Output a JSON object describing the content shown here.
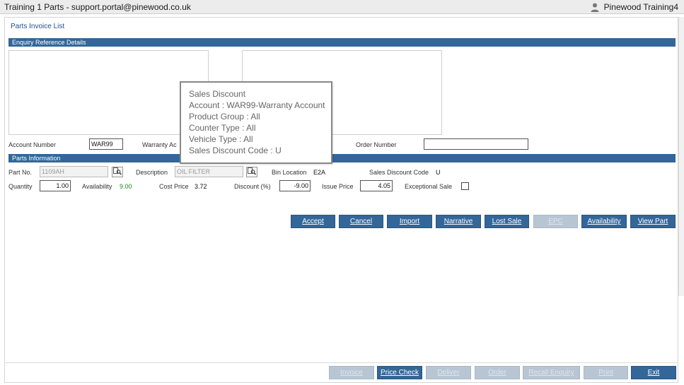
{
  "titlebar": {
    "title": "Training 1 Parts - support.portal@pinewood.co.uk",
    "user": "Pinewood Training4",
    "user_icon": "person-icon"
  },
  "page": {
    "title": "Parts Invoice List"
  },
  "enquiry": {
    "header": "Enquiry Reference Details",
    "account_number_label": "Account Number",
    "account_number_value": "WAR99",
    "warranty_label": "Warranty Ac",
    "order_number_label": "Order Number",
    "order_number_value": ""
  },
  "parts": {
    "header": "Parts Information",
    "part_no_label": "Part No.",
    "part_no_value": "1109AH",
    "description_label": "Description",
    "description_value": "OIL FILTER",
    "bin_location_label": "Bin Location",
    "bin_location_value": "E2A",
    "sales_discount_code_label": "Sales Discount Code",
    "sales_discount_code_value": "U",
    "quantity_label": "Quantity",
    "quantity_value": "1.00",
    "availability_label": "Availability",
    "availability_value": "9.00",
    "cost_price_label": "Cost Price",
    "cost_price_value": "3.72",
    "discount_label": "Discount (%)",
    "discount_value": "-9.00",
    "issue_price_label": "Issue Price",
    "issue_price_value": "4.05",
    "exceptional_sale_label": "Exceptional Sale"
  },
  "actions": {
    "accept": "Accept",
    "cancel": "Cancel",
    "import": "Import",
    "narrative": "Narrative",
    "lost_sale": "Lost Sale",
    "epc": "EPC",
    "availability": "Availability",
    "view_part": "View Part"
  },
  "footer": {
    "invoice": "Invoice",
    "price_check": "Price Check",
    "deliver": "Deliver",
    "order": "Order",
    "recall_enquiry": "Recall Enquiry",
    "print": "Print",
    "exit": "Exit"
  },
  "tooltip": {
    "line1": "Sales Discount",
    "line2": "Account : WAR99-Warranty Account",
    "line3": "Product Group : All",
    "line4": "Counter Type : All",
    "line5": "Vehicle Type : All",
    "line6": "Sales Discount Code : U"
  },
  "colors": {
    "header_blue": "#336699",
    "availability_green": "#1a8a1a",
    "title_blue": "#1f4f8a"
  }
}
